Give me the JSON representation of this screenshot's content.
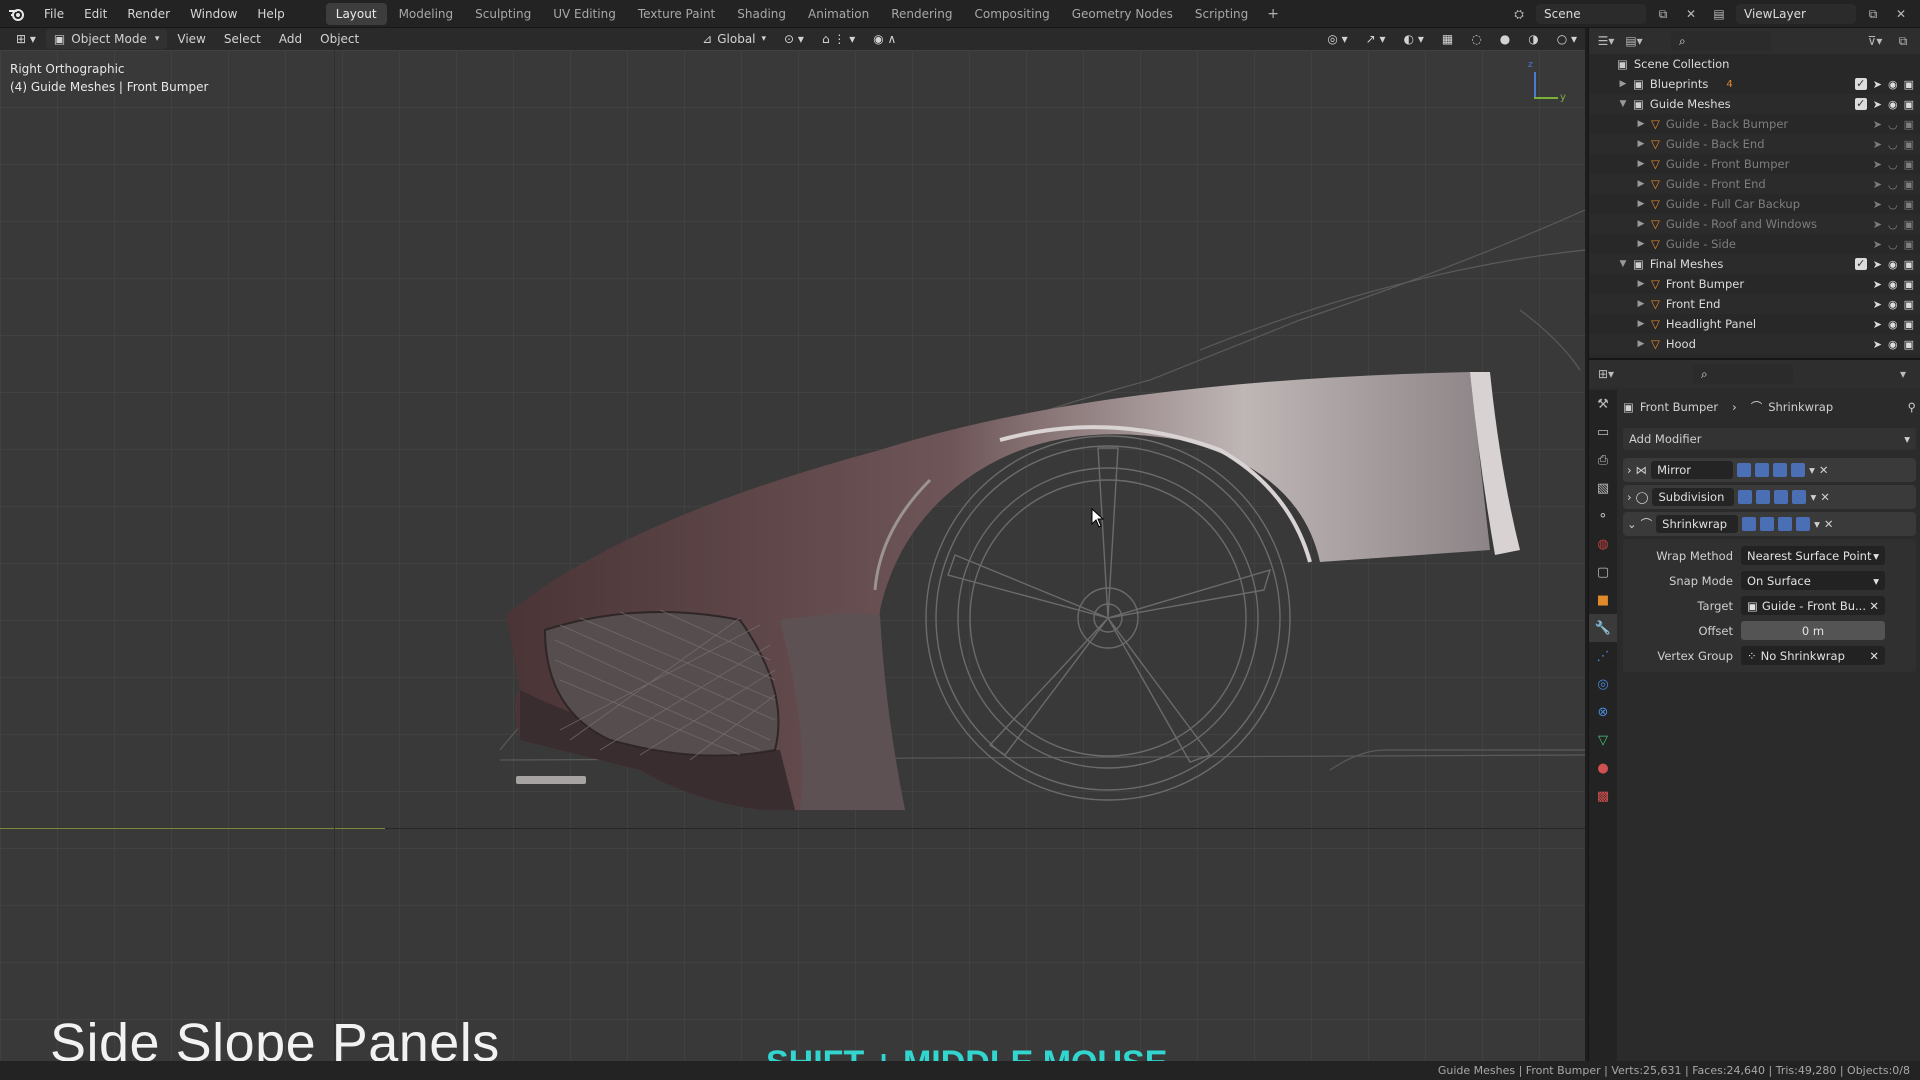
{
  "menubar": {
    "items": [
      "File",
      "Edit",
      "Render",
      "Window",
      "Help"
    ],
    "workspaces": [
      "Layout",
      "Modeling",
      "Sculpting",
      "UV Editing",
      "Texture Paint",
      "Shading",
      "Animation",
      "Rendering",
      "Compositing",
      "Geometry Nodes",
      "Scripting"
    ],
    "active_workspace": "Layout",
    "scene": "Scene",
    "view_layer": "ViewLayer"
  },
  "viewport_header": {
    "mode": "Object Mode",
    "menus": [
      "View",
      "Select",
      "Add",
      "Object"
    ],
    "transform_orientation": "Global"
  },
  "viewport": {
    "view_name": "Right Orthographic",
    "collection_info": "(4) Guide Meshes | Front Bumper",
    "title_overlay": "Side Slope Panels",
    "shortcut_overlay": "SHIFT + MIDDLE MOUSE",
    "shortcut_color": "#32d6cf",
    "axis_z": "z",
    "axis_y": "y"
  },
  "outliner": {
    "root": "Scene Collection",
    "rows": [
      {
        "label": "Blueprints",
        "level": 1,
        "dim": false
      },
      {
        "label": "Guide Meshes",
        "level": 1,
        "dim": false
      },
      {
        "label": "Guide - Back Bumper",
        "level": 2,
        "dim": true
      },
      {
        "label": "Guide - Back End",
        "level": 2,
        "dim": true
      },
      {
        "label": "Guide - Front Bumper",
        "level": 2,
        "dim": true
      },
      {
        "label": "Guide - Front End",
        "level": 2,
        "dim": true
      },
      {
        "label": "Guide - Full Car Backup",
        "level": 2,
        "dim": true
      },
      {
        "label": "Guide - Roof and Windows",
        "level": 2,
        "dim": true
      },
      {
        "label": "Guide - Side",
        "level": 2,
        "dim": true
      },
      {
        "label": "Final Meshes",
        "level": 1,
        "dim": false
      },
      {
        "label": "Front Bumper",
        "level": 2,
        "dim": false
      },
      {
        "label": "Front End",
        "level": 2,
        "dim": false
      },
      {
        "label": "Headlight Panel",
        "level": 2,
        "dim": false
      },
      {
        "label": "Hood",
        "level": 2,
        "dim": false
      }
    ],
    "blueprints_count": "4"
  },
  "properties": {
    "breadcrumb_object": "Front Bumper",
    "breadcrumb_modifier": "Shrinkwrap",
    "add_modifier": "Add Modifier",
    "modifiers": [
      "Mirror",
      "Subdivision",
      "Shrinkwrap"
    ],
    "shrinkwrap": {
      "wrap_method_label": "Wrap Method",
      "wrap_method": "Nearest Surface Point",
      "snap_mode_label": "Snap Mode",
      "snap_mode": "On Surface",
      "target_label": "Target",
      "target": "Guide - Front Bu...",
      "offset_label": "Offset",
      "offset": "0 m",
      "vertex_group_label": "Vertex Group",
      "vertex_group": "No Shrinkwrap"
    }
  },
  "statusbar": {
    "text": "Guide Meshes | Front Bumper | Verts:25,631 | Faces:24,640 | Tris:49,280 | Objects:0/8"
  }
}
